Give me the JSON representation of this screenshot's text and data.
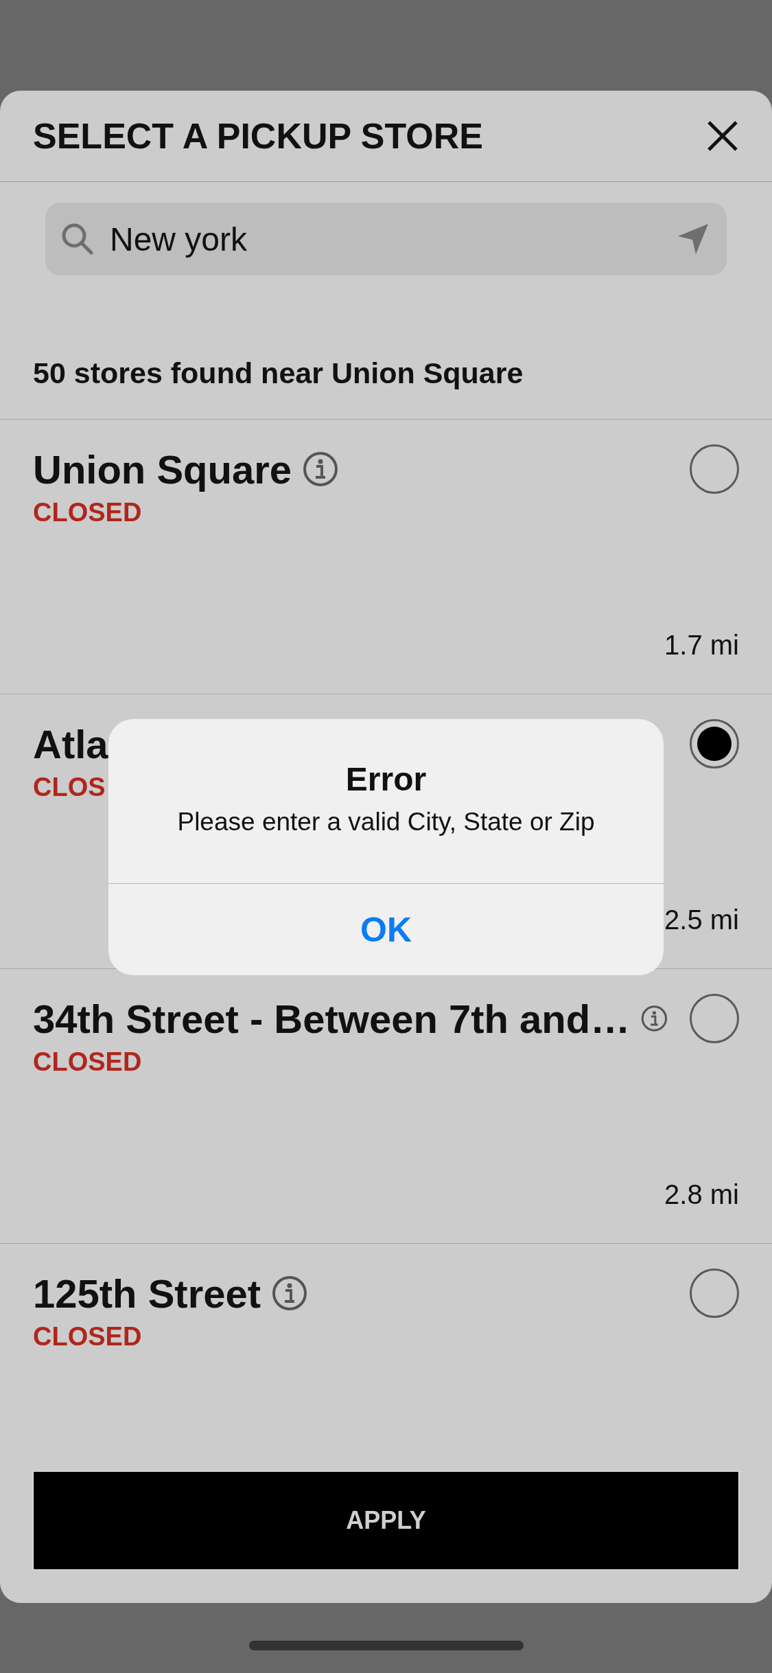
{
  "sheet": {
    "title": "SELECT A PICKUP STORE"
  },
  "search": {
    "value": "New york"
  },
  "result_count": "50 stores found near Union Square",
  "stores": [
    {
      "name": "Union Square",
      "status": "CLOSED",
      "distance": "1.7 mi",
      "info": true,
      "selected": false
    },
    {
      "name": "Atla",
      "status": "CLOS",
      "distance": "2.5 mi",
      "info": false,
      "selected": true
    },
    {
      "name": "34th Street - Between 7th and…",
      "status": "CLOSED",
      "distance": "2.8 mi",
      "info": true,
      "selected": false
    },
    {
      "name": "125th Street",
      "status": "CLOSED",
      "info": true,
      "selected": false
    }
  ],
  "apply_button": "APPLY",
  "alert": {
    "title": "Error",
    "message": "Please enter a valid City, State or Zip",
    "button": "OK"
  }
}
